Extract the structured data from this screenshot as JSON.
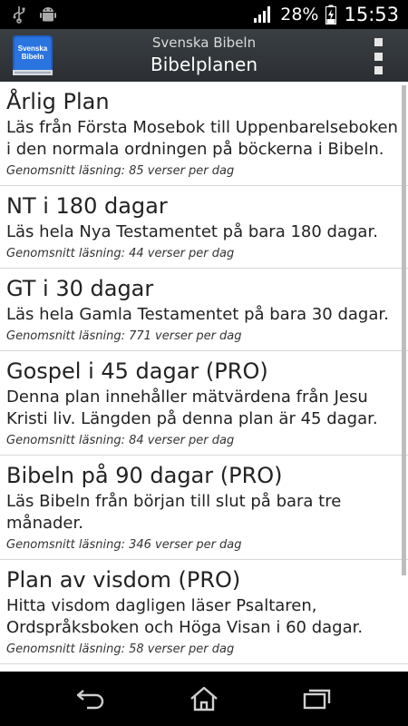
{
  "status_bar": {
    "battery": "28%",
    "time": "15:53",
    "icons": [
      "usb-icon",
      "android-icon",
      "signal-icon",
      "battery-icon"
    ]
  },
  "action_bar": {
    "app_icon_text": "Svenska Bibeln",
    "subtitle": "Svenska Bibeln",
    "title": "Bibelplanen"
  },
  "plans": [
    {
      "title": "Årlig Plan",
      "desc": "Läs från Första Mosebok till Uppenbarelseboken i den normala ordningen på böckerna i Bibeln.",
      "meta": "Genomsnitt läsning: 85 verser per dag"
    },
    {
      "title": "NT i 180 dagar",
      "desc": "Läs hela Nya Testamentet på bara 180 dagar.",
      "meta": "Genomsnitt läsning: 44 verser per dag"
    },
    {
      "title": "GT i 30 dagar",
      "desc": "Läs hela Gamla Testamentet på bara 30 dagar.",
      "meta": "Genomsnitt läsning: 771 verser per dag"
    },
    {
      "title": "Gospel i 45 dagar (PRO)",
      "desc": "Denna plan innehåller mätvärdena från Jesu Kristi liv. Längden på denna plan är 45 dagar.",
      "meta": "Genomsnitt läsning: 84 verser per dag"
    },
    {
      "title": "Bibeln på 90 dagar (PRO)",
      "desc": "Läs Bibeln från början till slut på bara tre månader.",
      "meta": "Genomsnitt läsning: 346 verser per dag"
    },
    {
      "title": "Plan av visdom (PRO)",
      "desc": "Hitta visdom dagligen läser Psaltaren, Ordspråksboken och Höga Visan i 60 dagar.",
      "meta": "Genomsnitt läsning: 58 verser per dag"
    }
  ],
  "nav_bar": {
    "buttons": [
      "back-icon",
      "home-icon",
      "recents-icon"
    ]
  },
  "colors": {
    "action_bar": "#2f3337",
    "list_bg": "#ffffff",
    "divider": "#d8d8d8",
    "app_icon_blue": "#2a6fd6"
  }
}
